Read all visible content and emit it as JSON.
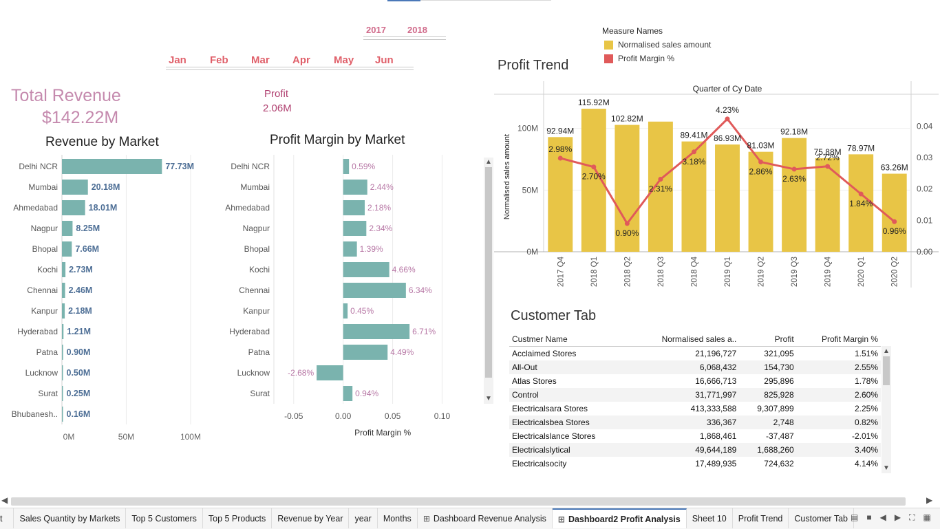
{
  "filters": {
    "years": [
      "2017",
      "2018"
    ],
    "months": [
      "Jan",
      "Feb",
      "Mar",
      "Apr",
      "May",
      "Jun"
    ]
  },
  "kpi": {
    "total_revenue_label": "Total Revenue",
    "total_revenue_value": "$142.22M",
    "profit_label": "Profit",
    "profit_value": "2.06M"
  },
  "revenue_by_market": {
    "title": "Revenue by Market",
    "chart_data": {
      "type": "bar",
      "orientation": "horizontal",
      "categories": [
        "Delhi NCR",
        "Mumbai",
        "Ahmedabad",
        "Nagpur",
        "Bhopal",
        "Kochi",
        "Chennai",
        "Kanpur",
        "Hyderabad",
        "Patna",
        "Lucknow",
        "Surat",
        "Bhubanesh.."
      ],
      "values": [
        77.73,
        20.18,
        18.01,
        8.25,
        7.66,
        2.73,
        2.46,
        2.18,
        1.21,
        0.9,
        0.5,
        0.25,
        0.16
      ],
      "labels": [
        "77.73M",
        "20.18M",
        "18.01M",
        "8.25M",
        "7.66M",
        "2.73M",
        "2.46M",
        "2.18M",
        "1.21M",
        "0.90M",
        "0.50M",
        "0.25M",
        "0.16M"
      ],
      "xticks": [
        "0M",
        "50M",
        "100M"
      ],
      "xlim": [
        0,
        115
      ],
      "bar_color": "#7ab3ae",
      "label_color": "#4e6f96"
    }
  },
  "profit_margin_by_market": {
    "title": "Profit Margin  by Market",
    "chart_data": {
      "type": "bar",
      "orientation": "horizontal",
      "categories": [
        "Delhi NCR",
        "Mumbai",
        "Ahmedabad",
        "Nagpur",
        "Bhopal",
        "Kochi",
        "Chennai",
        "Kanpur",
        "Hyderabad",
        "Patna",
        "Lucknow",
        "Surat"
      ],
      "values": [
        0.0059,
        0.0244,
        0.0218,
        0.0234,
        0.0139,
        0.0466,
        0.0634,
        0.0045,
        0.0671,
        0.0449,
        -0.0268,
        0.0094
      ],
      "labels": [
        "0.59%",
        "2.44%",
        "2.18%",
        "2.34%",
        "1.39%",
        "4.66%",
        "6.34%",
        "0.45%",
        "6.71%",
        "4.49%",
        "-2.68%",
        "0.94%"
      ],
      "xticks": [
        "-0.05",
        "0.00",
        "0.05",
        "0.10"
      ],
      "xtick_values": [
        -0.05,
        0,
        0.05,
        0.1
      ],
      "xlim": [
        -0.07,
        0.14
      ],
      "xlabel": "Profit Margin %",
      "bar_color": "#7ab3ae",
      "label_color": "#b777a5"
    }
  },
  "profit_trend": {
    "title": "Profit Trend",
    "legend": {
      "title": "Measure Names",
      "items": [
        {
          "label": "Normalised sales amount",
          "color": "#e8c546"
        },
        {
          "label": "Profit Margin %",
          "color": "#e05a5a"
        }
      ]
    },
    "chart_data": {
      "type": "bar+line",
      "header": "Quarter of Cy Date",
      "categories": [
        "2017 Q4",
        "2018 Q1",
        "2018 Q2",
        "2018 Q3",
        "2018 Q4",
        "2019 Q1",
        "2019 Q2",
        "2019 Q3",
        "2019 Q4",
        "2020 Q1",
        "2020 Q2"
      ],
      "series": [
        {
          "name": "Normalised sales amount",
          "values": [
            92.94,
            115.92,
            102.82,
            105.5,
            89.41,
            86.93,
            81.03,
            92.18,
            75.88,
            78.97,
            63.26
          ],
          "labels": [
            "92.94M",
            "115.92M",
            "102.82M",
            "",
            "89.41M",
            "86.93M",
            "81.03M",
            "92.18M",
            "75.88M",
            "78.97M",
            "63.26M"
          ]
        },
        {
          "name": "Profit Margin %",
          "values": [
            0.0298,
            0.027,
            0.009,
            0.0231,
            0.0318,
            0.0423,
            0.0286,
            0.0263,
            0.0272,
            0.0184,
            0.0096
          ],
          "labels": [
            "2.98%",
            "2.70%",
            "0.90%",
            "2.31%",
            "3.18%",
            "4.23%",
            "2.86%",
            "2.63%",
            "2.72%",
            "1.84%",
            "0.96%"
          ]
        }
      ],
      "ylabel": "Normalised sales amount",
      "yticks": [
        "0M",
        "50M",
        "100M"
      ],
      "ytick_values": [
        0,
        50,
        100
      ],
      "ylim": [
        0,
        126
      ],
      "y2ticks": [
        "0.00",
        "0.01",
        "0.02",
        "0.03",
        "0.04"
      ],
      "y2tick_values": [
        0,
        0.01,
        0.02,
        0.03,
        0.04
      ],
      "y2lim": [
        0,
        0.0495
      ]
    }
  },
  "customer_tab": {
    "title": "Customer Tab",
    "columns": [
      "Custmer Name",
      "Normalised sales a..",
      "Profit",
      "Profit Margin %"
    ],
    "rows": [
      [
        "Acclaimed Stores",
        "21,196,727",
        "321,095",
        "1.51%"
      ],
      [
        "All-Out",
        "6,068,432",
        "154,730",
        "2.55%"
      ],
      [
        "Atlas Stores",
        "16,666,713",
        "295,896",
        "1.78%"
      ],
      [
        "Control",
        "31,771,997",
        "825,928",
        "2.60%"
      ],
      [
        "Electricalsara Stores",
        "413,333,588",
        "9,307,899",
        "2.25%"
      ],
      [
        "Electricalsbea Stores",
        "336,367",
        "2,748",
        "0.82%"
      ],
      [
        "Electricalslance Stores",
        "1,868,461",
        "-37,487",
        "-2.01%"
      ],
      [
        "Electricalslytical",
        "49,644,189",
        "1,688,260",
        "3.40%"
      ],
      [
        "Electricalsocity",
        "17,489,935",
        "724,632",
        "4.14%"
      ]
    ]
  },
  "tabs": [
    {
      "label": "t",
      "icon": "",
      "active": false
    },
    {
      "label": "Sales Quantity by Markets",
      "icon": "",
      "active": false
    },
    {
      "label": "Top 5 Customers",
      "icon": "",
      "active": false
    },
    {
      "label": "Top 5 Products",
      "icon": "",
      "active": false
    },
    {
      "label": "Revenue by Year",
      "icon": "",
      "active": false
    },
    {
      "label": "year",
      "icon": "",
      "active": false
    },
    {
      "label": "Months",
      "icon": "",
      "active": false
    },
    {
      "label": "Dashboard Revenue Analysis",
      "icon": "grid-icon",
      "active": false
    },
    {
      "label": "Dashboard2 Profit Analysis",
      "icon": "grid-icon",
      "active": true
    },
    {
      "label": "Sheet 10",
      "icon": "",
      "active": false
    },
    {
      "label": "Profit Trend",
      "icon": "",
      "active": false
    },
    {
      "label": "Customer Tab",
      "icon": "",
      "active": false
    }
  ],
  "icons": {
    "grid": "grid-icon",
    "scroll_up": "chevron-up-icon",
    "scroll_down": "chevron-down-icon",
    "scroll_left": "chevron-left-icon",
    "scroll_right": "chevron-right-icon",
    "filmstrip": "filmstrip-icon",
    "sheet_view": "sheet-view-icon",
    "first_sheet": "first-sheet-icon",
    "prev_sheet": "prev-sheet-icon",
    "next_sheet": "next-sheet-icon",
    "fit": "fit-icon",
    "grid_view": "grid-view-icon"
  }
}
